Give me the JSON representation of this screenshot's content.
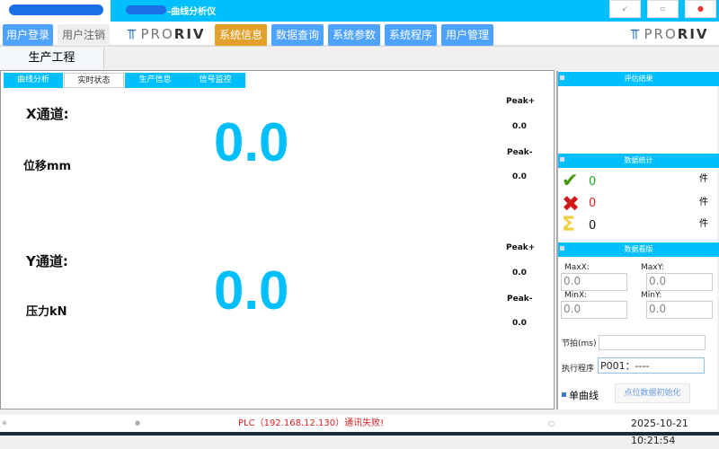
{
  "title": {
    "suffix": "-曲线分析仪",
    "controls": [
      "minimize",
      "restore",
      "close"
    ]
  },
  "nav": {
    "login": "用户登录",
    "logout": "用户注销",
    "logo": {
      "pro": "PRO",
      "riv": "RIV"
    },
    "items": [
      "系统信息",
      "数据查询",
      "系统参数",
      "系统程序",
      "用户管理"
    ],
    "active": "系统信息"
  },
  "page_tab": "生产工程",
  "sub_tabs": [
    "曲线分析",
    "实时状态",
    "生产信息",
    "信号监控"
  ],
  "active_sub_tab": "实时状态",
  "x_channel": {
    "label": "X通道:",
    "unit_label": "位移mm",
    "value": "0.0",
    "peak_plus_label": "Peak+",
    "peak_plus": "0.0",
    "peak_minus_label": "Peak-",
    "peak_minus": "0.0"
  },
  "y_channel": {
    "label": "Y通道:",
    "unit_label": "压力kN",
    "value": "0.0",
    "peak_plus_label": "Peak+",
    "peak_plus": "0.0",
    "peak_minus_label": "Peak-",
    "peak_minus": "0.0"
  },
  "right": {
    "eval_title": "评估结果",
    "stats_title": "数据统计",
    "stats": [
      {
        "icon": "check",
        "count": "0",
        "unit": "件",
        "color": "#22aa22"
      },
      {
        "icon": "cross",
        "count": "0",
        "unit": "件",
        "color": "#e02020"
      },
      {
        "icon": "sum",
        "count": "0",
        "unit": "件",
        "color": "#111111"
      }
    ],
    "board_title": "数据看版",
    "maxx_label": "MaxX:",
    "maxx": "0.0",
    "maxy_label": "MaxY:",
    "maxy": "0.0",
    "minx_label": "MinX:",
    "minx": "0.0",
    "miny_label": "MinY:",
    "miny": "0.0",
    "cycle_label": "节拍(ms)",
    "cycle_value": "",
    "program_label": "执行程序",
    "program_value": "P001：----",
    "single_curve_label": "单曲线",
    "single_curve_checked": true,
    "init_button": "点位数据初始化"
  },
  "status": {
    "message": "PLC（192.168.12.130）通讯失败!",
    "datetime": "2025-10-21 10:21:54"
  }
}
